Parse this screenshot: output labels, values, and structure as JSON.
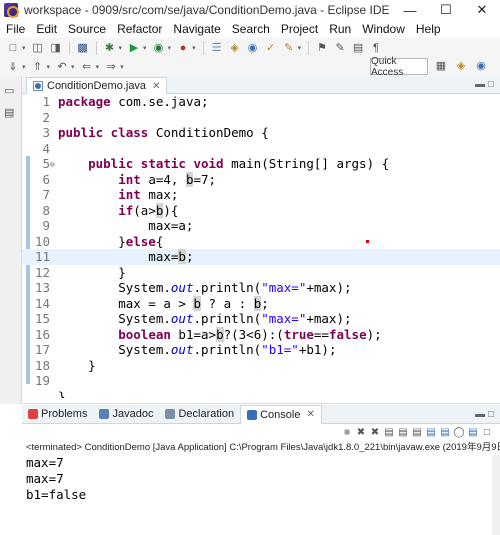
{
  "window": {
    "title": "workspace - 0909/src/com/se/java/ConditionDemo.java - Eclipse IDE",
    "minimize": "—",
    "maximize": "☐",
    "close": "✕"
  },
  "menu": [
    "File",
    "Edit",
    "Source",
    "Refactor",
    "Navigate",
    "Search",
    "Project",
    "Run",
    "Window",
    "Help"
  ],
  "toolbar": {
    "quick_access": "Quick Access"
  },
  "editor": {
    "tab_label": "ConditionDemo.java",
    "tab_close": "✕",
    "lines": [
      "1",
      "2",
      "3",
      "4",
      "5",
      "6",
      "7",
      "8",
      "9",
      "10",
      "11",
      "12",
      "13",
      "14",
      "15",
      "16",
      "17",
      "18",
      "19"
    ]
  },
  "panel": {
    "tabs": [
      "Problems",
      "Javadoc",
      "Declaration",
      "Console"
    ],
    "console_close": "✕",
    "status": "<terminated> ConditionDemo [Java Application] C:\\Program Files\\Java\\jdk1.8.0_221\\bin\\javaw.exe (2019年9月9日 下",
    "output": [
      "max=7",
      "max=7",
      "b1=false"
    ]
  }
}
